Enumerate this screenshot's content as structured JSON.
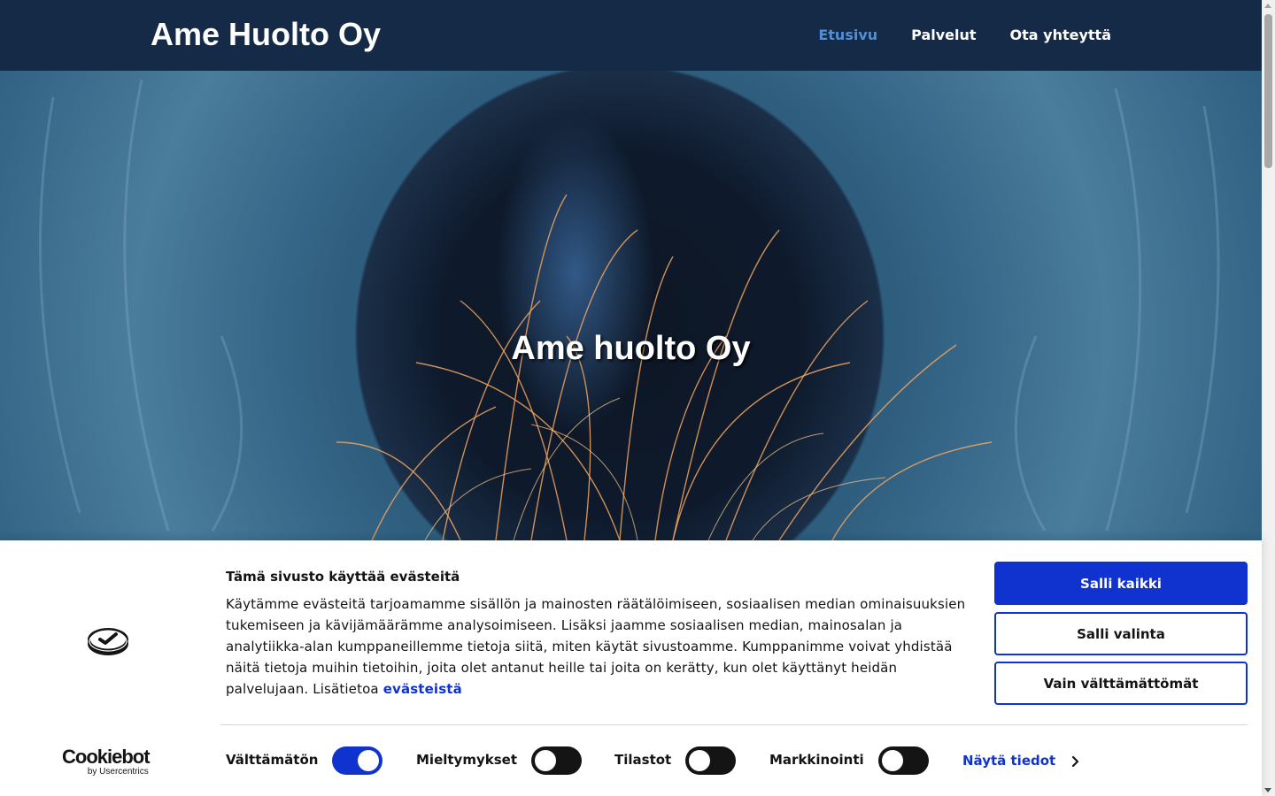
{
  "header": {
    "brand": "Ame Huolto Oy",
    "nav": [
      {
        "label": "Etusivu",
        "active": true
      },
      {
        "label": "Palvelut",
        "active": false
      },
      {
        "label": "Ota yhteyttä",
        "active": false
      }
    ]
  },
  "hero": {
    "title": "Ame huolto Oy"
  },
  "cookie_banner": {
    "title": "Tämä sivusto käyttää evästeitä",
    "body": "Käytämme evästeitä tarjoamamme sisällön ja mainosten räätälöimiseen, sosiaalisen median ominaisuuksien tukemiseen ja kävijämäärämme analysoimiseen. Lisäksi jaamme sosiaalisen median, mainosalan ja analytiikka-alan kumppaneillemme tietoja siitä, miten käytät sivustoamme. Kumppanimme voivat yhdistää näitä tietoja muihin tietoihin, joita olet antanut heille tai joita on kerätty, kun olet käyttänyt heidän palvelujaan. Lisätietoa",
    "link_label": "evästeistä",
    "buttons": {
      "allow_all": "Salli kaikki",
      "allow_selection": "Salli valinta",
      "necessary_only": "Vain välttämättömät"
    },
    "toggles": [
      {
        "label": "Välttämätön",
        "checked": true
      },
      {
        "label": "Mieltymykset",
        "checked": false
      },
      {
        "label": "Tilastot",
        "checked": false
      },
      {
        "label": "Markkinointi",
        "checked": false
      }
    ],
    "details_label": "Näytä tiedot",
    "brand": {
      "name": "Cookiebot",
      "byline": "by Usercentrics"
    },
    "colors": {
      "accent": "#1032cf",
      "header_bg": "#152a47",
      "nav_active": "#4f8fd6"
    }
  }
}
